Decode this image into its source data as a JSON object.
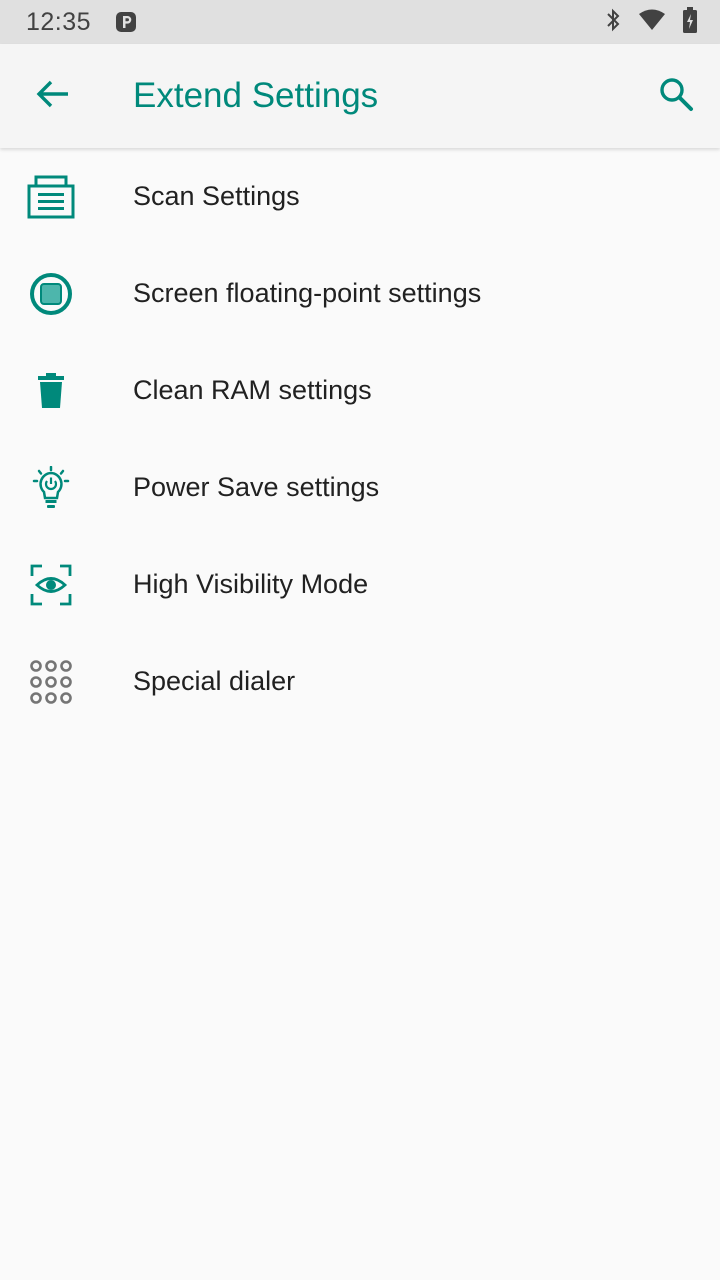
{
  "status_bar": {
    "time": "12:35",
    "icons": [
      "p-icon",
      "bluetooth-icon",
      "wifi-icon",
      "battery-icon"
    ]
  },
  "app_bar": {
    "title": "Extend Settings",
    "back_icon": "arrow-back-icon",
    "search_icon": "search-icon"
  },
  "colors": {
    "accent": "#00897b",
    "text": "#212121",
    "background": "#fafafa",
    "grid_icon": "#757575"
  },
  "items": [
    {
      "label": "Scan Settings",
      "icon": "scanner-icon"
    },
    {
      "label": "Screen floating-point settings",
      "icon": "floating-point-icon"
    },
    {
      "label": "Clean RAM settings",
      "icon": "trash-icon"
    },
    {
      "label": "Power Save settings",
      "icon": "lightbulb-power-icon"
    },
    {
      "label": "High Visibility Mode",
      "icon": "visibility-focus-icon"
    },
    {
      "label": "Special dialer",
      "icon": "dialpad-icon"
    }
  ]
}
